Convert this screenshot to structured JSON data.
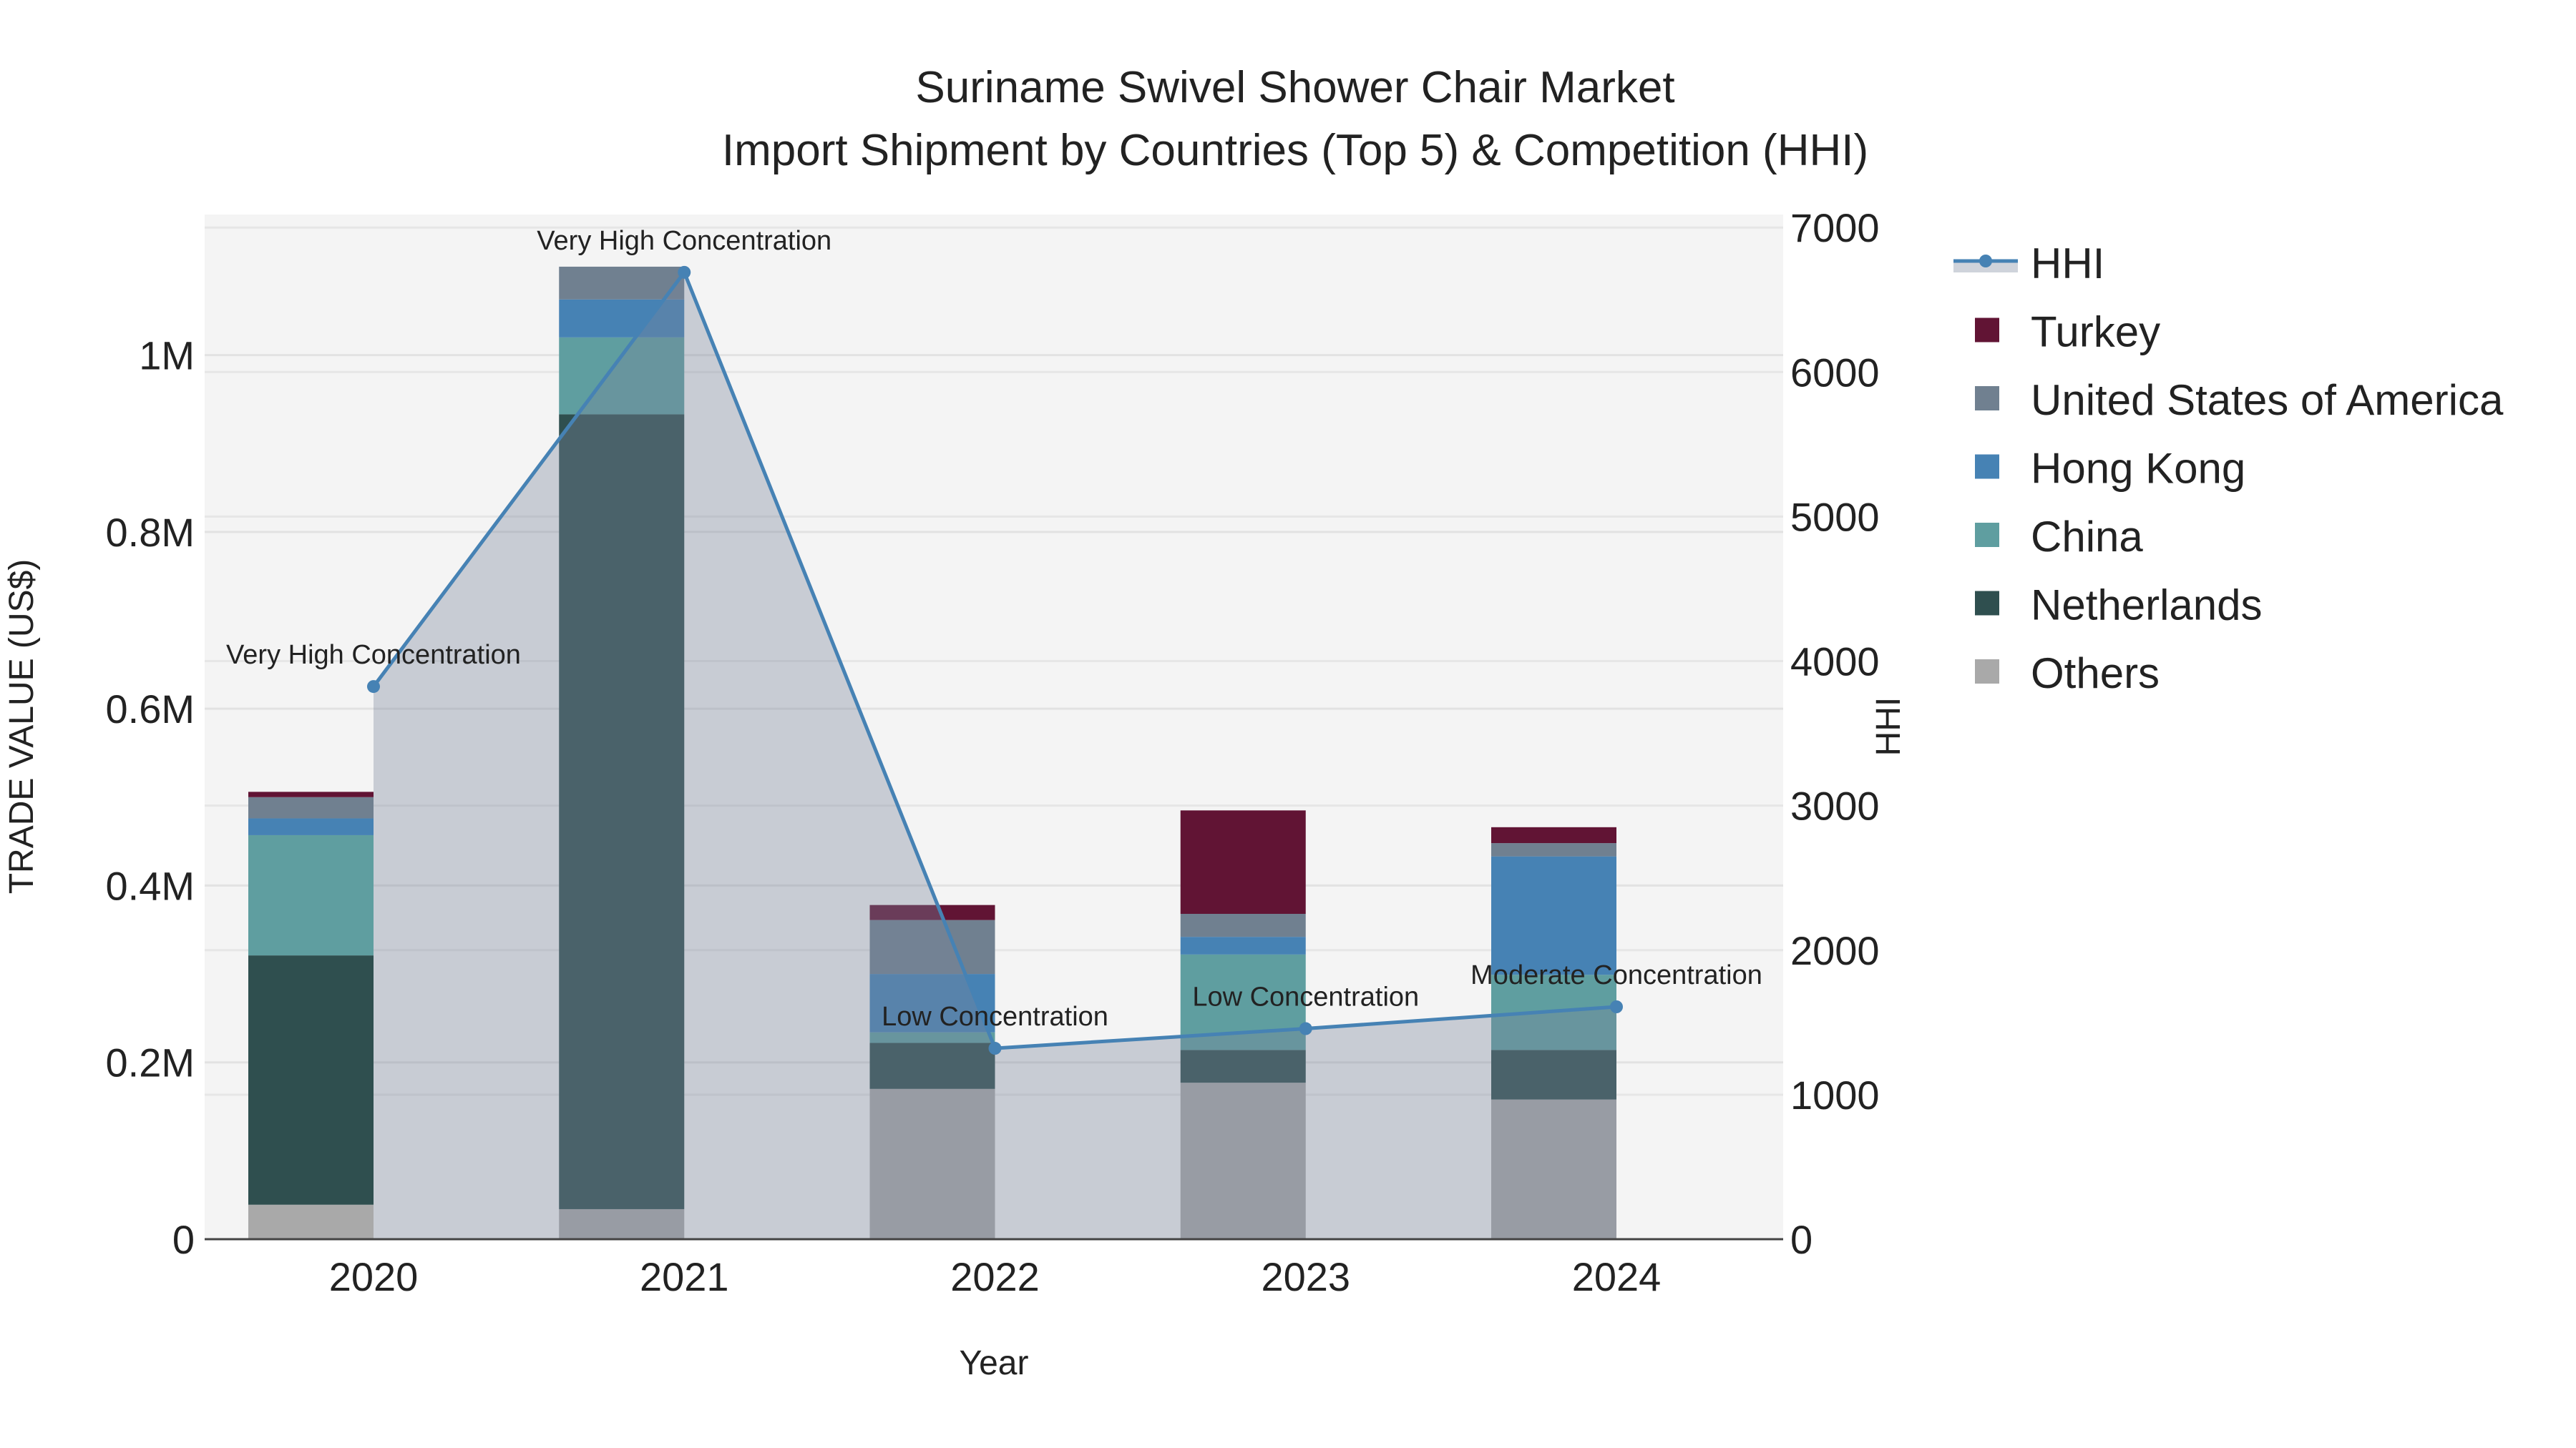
{
  "chart_data": {
    "type": "bar",
    "title": "Suriname Swivel Shower Chair Market",
    "subtitle": "Import Shipment by Countries (Top 5) & Competition (HHI)",
    "xlabel": "Year",
    "ylabel": "TRADE VALUE (US$)",
    "y2label": "HHI",
    "categories": [
      "2020",
      "2021",
      "2022",
      "2023",
      "2024"
    ],
    "ylim": [
      0,
      1159000
    ],
    "y2lim": [
      0,
      7090
    ],
    "yticks": [
      {
        "v": 0,
        "label": "0"
      },
      {
        "v": 200000,
        "label": "0.2M"
      },
      {
        "v": 400000,
        "label": "0.4M"
      },
      {
        "v": 600000,
        "label": "0.6M"
      },
      {
        "v": 800000,
        "label": "0.8M"
      },
      {
        "v": 1000000,
        "label": "1M"
      }
    ],
    "y2ticks": [
      {
        "v": 0,
        "label": "0"
      },
      {
        "v": 1000,
        "label": "1000"
      },
      {
        "v": 2000,
        "label": "2000"
      },
      {
        "v": 3000,
        "label": "3000"
      },
      {
        "v": 4000,
        "label": "4000"
      },
      {
        "v": 5000,
        "label": "5000"
      },
      {
        "v": 6000,
        "label": "6000"
      },
      {
        "v": 7000,
        "label": "7000"
      }
    ],
    "grid": true,
    "legend_placement": "right",
    "series": [
      {
        "name": "Others",
        "color": "#a9a9a9",
        "values": [
          39000,
          34000,
          170000,
          177000,
          158000
        ]
      },
      {
        "name": "Netherlands",
        "color": "#2f4f4f",
        "values": [
          282000,
          899000,
          52000,
          37000,
          56000
        ]
      },
      {
        "name": "China",
        "color": "#5f9ea0",
        "values": [
          136000,
          87000,
          12000,
          108000,
          85000
        ]
      },
      {
        "name": "Hong Kong",
        "color": "#4682b4",
        "values": [
          19000,
          43000,
          66000,
          20000,
          134000
        ]
      },
      {
        "name": "United States of America",
        "color": "#708090",
        "values": [
          24000,
          37000,
          61000,
          26000,
          15000
        ]
      },
      {
        "name": "Turkey",
        "color": "#611434",
        "values": [
          6000,
          0,
          17000,
          117000,
          18000
        ]
      }
    ],
    "hhi": {
      "name": "HHI",
      "color": "#4682b4",
      "values": [
        3824,
        6690,
        1321,
        1457,
        1608
      ],
      "annotations": [
        "Very High Concentration",
        "Very High Concentration",
        "Low Concentration",
        "Low Concentration",
        "Moderate Concentration"
      ]
    },
    "legend_order": [
      "HHI",
      "Turkey",
      "United States of America",
      "Hong Kong",
      "China",
      "Netherlands",
      "Others"
    ]
  }
}
